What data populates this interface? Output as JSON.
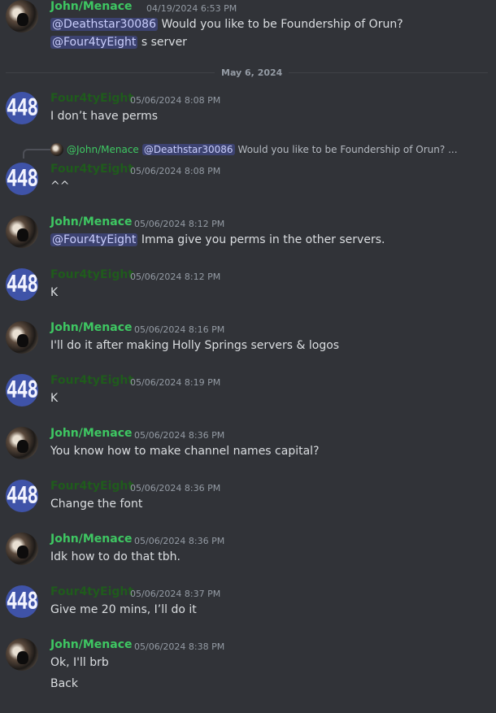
{
  "messages": [
    {
      "author": "John/Menace",
      "timestamp": "04/19/2024 6:53 PM",
      "line1_mention": "@Deathstar30086",
      "line1_text": " Would you like to be Foundership of Orun?",
      "line2_mention": "@Four4tyEight",
      "line2_text": " s server"
    },
    {
      "author": "Four4tyEight",
      "timestamp": "05/06/2024 8:08 PM",
      "text": "I don’t have perms"
    },
    {
      "author": "Four4tyEight",
      "timestamp": "05/06/2024 8:08 PM",
      "text": "^^"
    },
    {
      "author": "John/Menace",
      "timestamp": "05/06/2024 8:12 PM",
      "mention": "@Four4tyEight",
      "text": " Imma give you perms in the other servers."
    },
    {
      "author": "Four4tyEight",
      "timestamp": "05/06/2024 8:12 PM",
      "text": "K"
    },
    {
      "author": "John/Menace",
      "timestamp": "05/06/2024 8:16 PM",
      "text": "I'll do it after making Holly Springs servers & logos"
    },
    {
      "author": "Four4tyEight",
      "timestamp": "05/06/2024 8:19 PM",
      "text": "K"
    },
    {
      "author": "John/Menace",
      "timestamp": "05/06/2024 8:36 PM",
      "text": "You know how to make channel names capital?"
    },
    {
      "author": "Four4tyEight",
      "timestamp": "05/06/2024 8:36 PM",
      "text": "Change the font"
    },
    {
      "author": "John/Menace",
      "timestamp": "05/06/2024 8:36 PM",
      "text": "Idk how to do that tbh."
    },
    {
      "author": "Four4tyEight",
      "timestamp": "05/06/2024 8:37 PM",
      "text": "Give me 20 mins, I’ll do it"
    },
    {
      "author": "John/Menace",
      "timestamp": "05/06/2024 8:38 PM",
      "text": "Ok, I'll brb",
      "text2": "Back"
    }
  ],
  "date_divider": "May 6, 2024",
  "reply": {
    "author": "@John/Menace",
    "mention": "@Deathstar30086",
    "text": "Would you like to be Foundership of Orun? ..."
  },
  "avatar_text": "448",
  "colors": {
    "background": "#313338",
    "john_name": "#3ec762",
    "four_name": "#1f5b1c",
    "mention_bg": "#3c4270",
    "timestamp": "#949ba4"
  }
}
